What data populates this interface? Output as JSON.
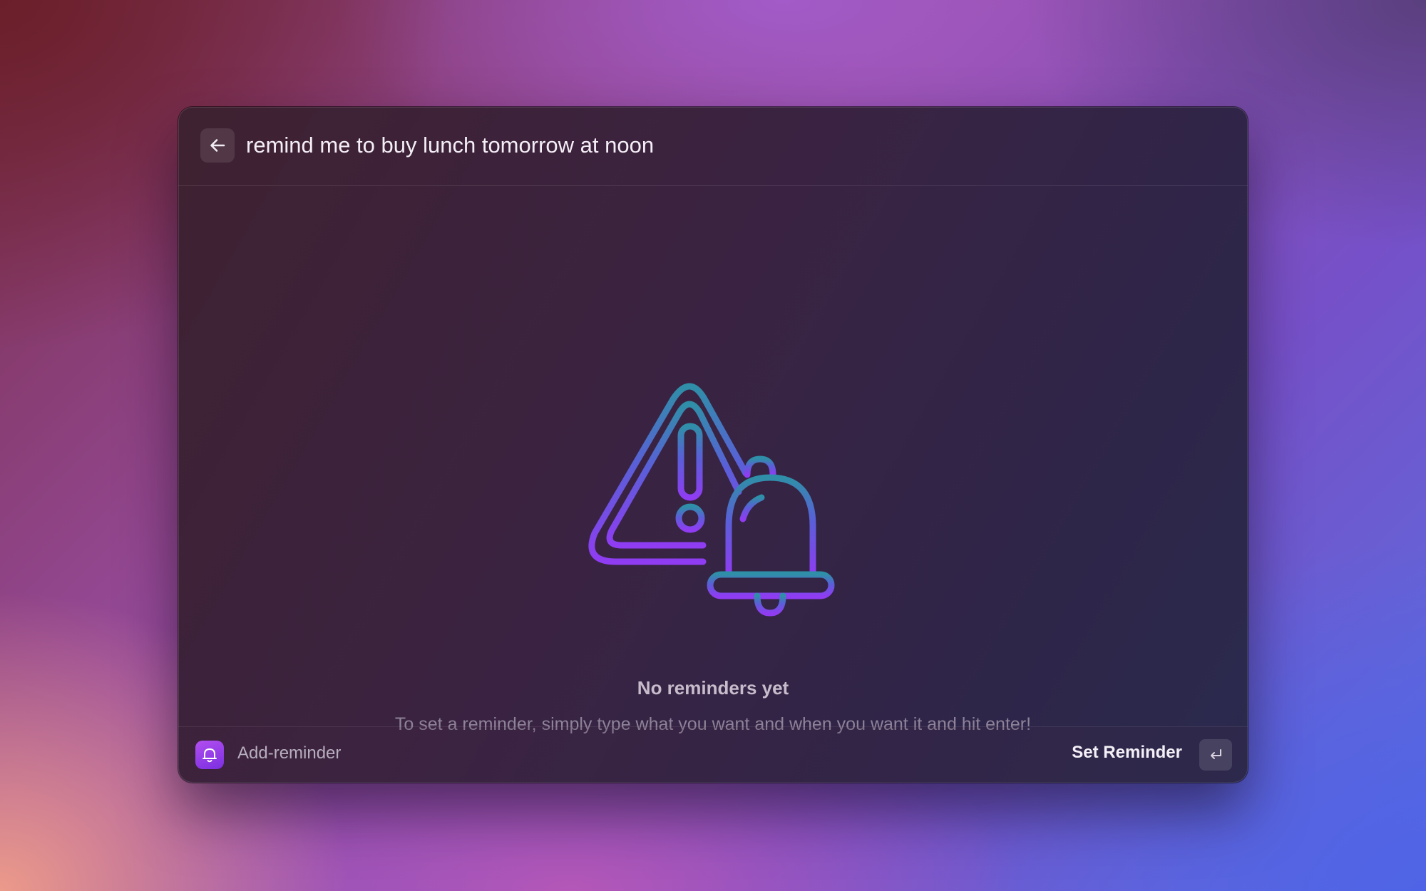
{
  "search": {
    "value": "remind me to buy lunch tomorrow at noon"
  },
  "empty_state": {
    "title": "No reminders yet",
    "description": "To set a reminder, simply type what you want and when you want it and hit enter!"
  },
  "footer": {
    "app_name": "Add-reminder",
    "primary_action_label": "Set Reminder",
    "shortcut_icon": "return-key-icon"
  },
  "icons": {
    "back": "arrow-left-icon",
    "app": "bell-icon",
    "illustration": "warning-triangle-bell-icon"
  },
  "colors": {
    "accent_purple": "#8b3cf0",
    "accent_blue": "#3f6fd0",
    "accent_teal": "#2e8fa8"
  }
}
